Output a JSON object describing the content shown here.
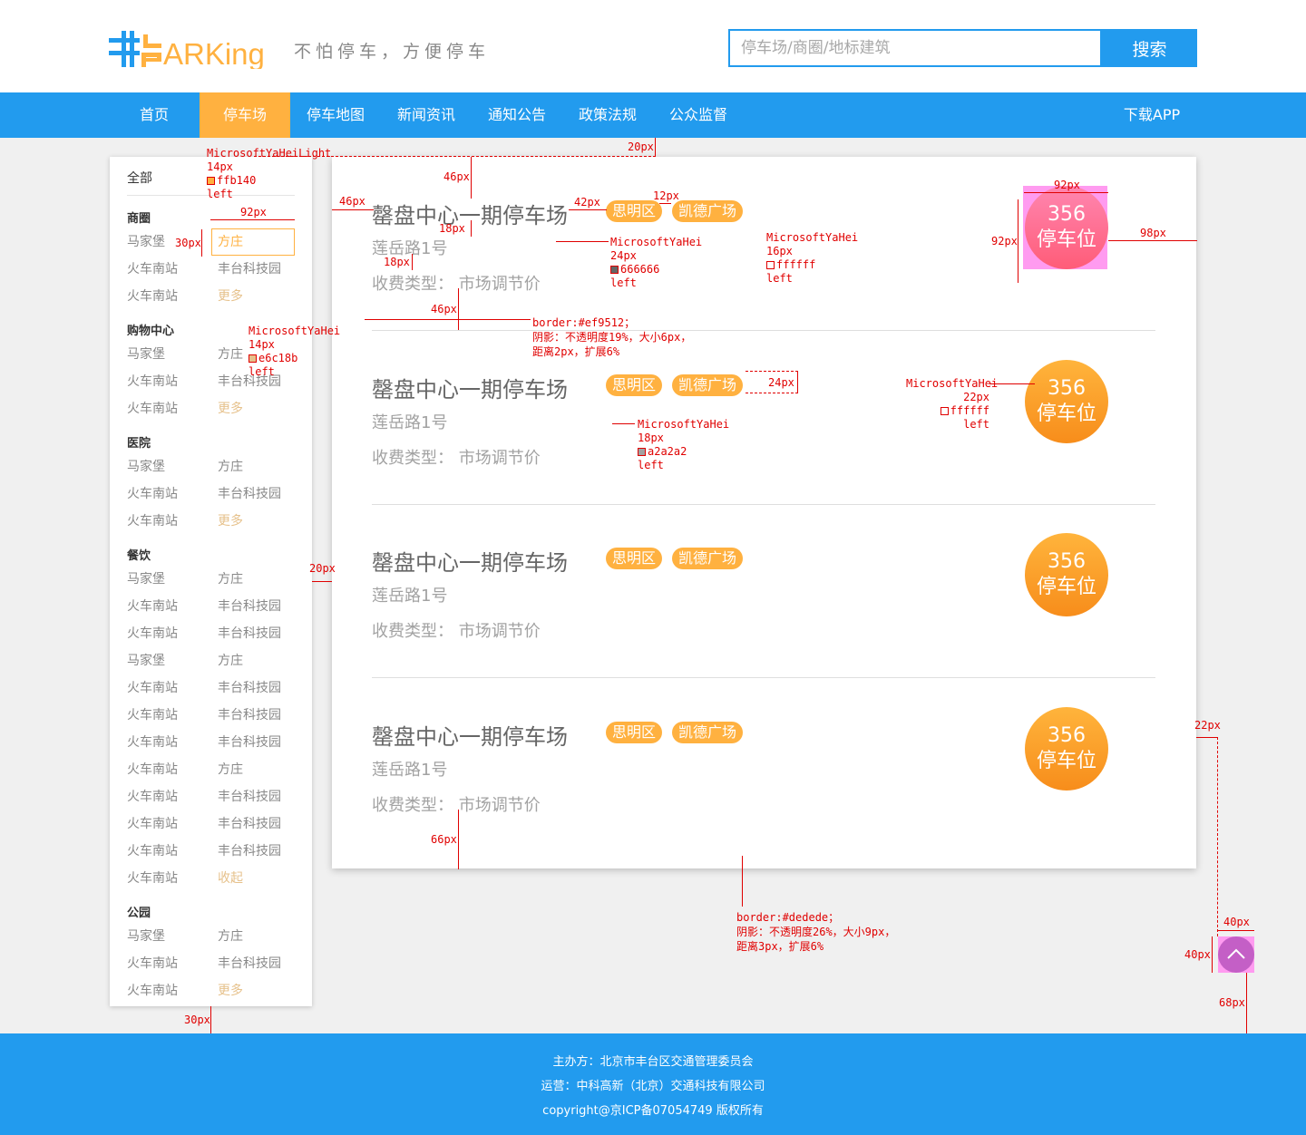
{
  "brand": {
    "logo_text": "非PARKing",
    "slogan": "不怕停车，方便停车"
  },
  "search": {
    "placeholder": "停车场/商圈/地标建筑",
    "button": "搜索"
  },
  "nav": {
    "items": [
      "首页",
      "停车场",
      "停车地图",
      "新闻资讯",
      "通知公告",
      "政策法规",
      "公众监督"
    ],
    "active": "停车场",
    "download": "下载APP"
  },
  "sidebar": {
    "all": "全部",
    "groups": [
      {
        "title": "商圈",
        "rows": [
          [
            "马家堡",
            "方庄"
          ],
          [
            "火车南站",
            "丰台科技园"
          ],
          [
            "火车南站",
            "更多"
          ]
        ]
      },
      {
        "title": "购物中心",
        "rows": [
          [
            "马家堡",
            "方庄"
          ],
          [
            "火车南站",
            "丰台科技园"
          ],
          [
            "火车南站",
            "更多"
          ]
        ]
      },
      {
        "title": "医院",
        "rows": [
          [
            "马家堡",
            "方庄"
          ],
          [
            "火车南站",
            "丰台科技园"
          ],
          [
            "火车南站",
            "更多"
          ]
        ]
      },
      {
        "title": "餐饮",
        "rows": [
          [
            "马家堡",
            "方庄"
          ],
          [
            "火车南站",
            "丰台科技园"
          ],
          [
            "火车南站",
            "丰台科技园"
          ],
          [
            "马家堡",
            "方庄"
          ],
          [
            "火车南站",
            "丰台科技园"
          ],
          [
            "火车南站",
            "丰台科技园"
          ],
          [
            "火车南站",
            "丰台科技园"
          ],
          [
            "火车南站",
            "方庄"
          ],
          [
            "火车南站",
            "丰台科技园"
          ],
          [
            "火车南站",
            "丰台科技园"
          ],
          [
            "火车南站",
            "丰台科技园"
          ],
          [
            "火车南站",
            "收起"
          ]
        ]
      },
      {
        "title": "公园",
        "rows": [
          [
            "马家堡",
            "方庄"
          ],
          [
            "火车南站",
            "丰台科技园"
          ],
          [
            "火车南站",
            "更多"
          ]
        ]
      }
    ]
  },
  "parking_lots": [
    {
      "name": "罄盘中心一期停车场",
      "tags": [
        "思明区",
        "凯德广场"
      ],
      "address": "莲岳路1号",
      "fee_label": "收费类型：",
      "fee_value": "市场调节价",
      "spaces": "356",
      "spaces_unit": "停车位"
    },
    {
      "name": "罄盘中心一期停车场",
      "tags": [
        "思明区",
        "凯德广场"
      ],
      "address": "莲岳路1号",
      "fee_label": "收费类型：",
      "fee_value": "市场调节价",
      "spaces": "356",
      "spaces_unit": "停车位"
    },
    {
      "name": "罄盘中心一期停车场",
      "tags": [
        "思明区",
        "凯德广场"
      ],
      "address": "莲岳路1号",
      "fee_label": "收费类型：",
      "fee_value": "市场调节价",
      "spaces": "356",
      "spaces_unit": "停车位"
    },
    {
      "name": "罄盘中心一期停车场",
      "tags": [
        "思明区",
        "凯德广场"
      ],
      "address": "莲岳路1号",
      "fee_label": "收费类型：",
      "fee_value": "市场调节价",
      "spaces": "356",
      "spaces_unit": "停车位"
    }
  ],
  "footer": {
    "host": "主办方：北京市丰台区交通管理委员会",
    "operator": "运营：中科高新（北京）交通科技有限公司",
    "copyright": "copyright@京ICP备07054749  版权所有"
  },
  "annotations": {
    "sidebar_font": [
      "MicrosoftYaHeiLight",
      "14px",
      "ffb140",
      "left"
    ],
    "more_font": [
      "MicrosoftYaHei",
      "14px",
      "e6c18b",
      "left"
    ],
    "name_font": [
      "MicrosoftYaHei",
      "24px",
      "666666",
      "left"
    ],
    "tag_font": [
      "MicrosoftYaHei",
      "16px",
      "ffffff",
      "left"
    ],
    "addr_font": [
      "MicrosoftYaHei",
      "18px",
      "a2a2a2",
      "left"
    ],
    "badge_font": [
      "MicrosoftYaHei",
      "22px",
      "ffffff",
      "left"
    ],
    "sel_border": [
      "border:#ef9512；",
      "阴影：不透明度19%，大小6px，",
      "距离2px，扩展6%"
    ],
    "main_border": [
      "border:#dedede；",
      "阴影：不透明度26%，大小9px，",
      "距离3px，扩展6%"
    ],
    "dims": [
      "20px",
      "46px",
      "46px",
      "42px",
      "12px",
      "18px",
      "18px",
      "46px",
      "92px",
      "30px",
      "92px",
      "92px",
      "98px",
      "24px",
      "20px",
      "66px",
      "22px",
      "40px",
      "40px",
      "68px",
      "30px"
    ]
  },
  "colors": {
    "primary": "#229bee",
    "accent": "#ffb140",
    "more": "#e6c18b",
    "annotation": "#e00000"
  }
}
